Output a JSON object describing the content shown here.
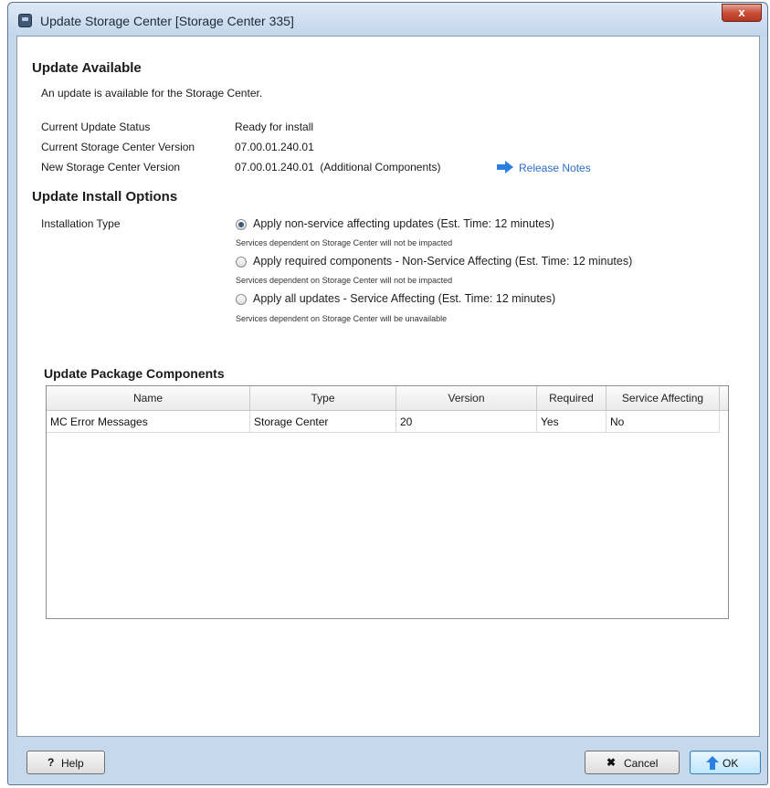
{
  "window": {
    "title": "Update Storage Center [Storage Center 335]",
    "close_glyph": "x"
  },
  "update_available": {
    "heading": "Update Available",
    "description": "An update is available for the Storage Center.",
    "rows": [
      {
        "label": "Current Update Status",
        "value": "Ready for install"
      },
      {
        "label": "Current Storage Center Version",
        "value": "07.00.01.240.01"
      },
      {
        "label": "New Storage Center Version",
        "value": "07.00.01.240.01  (Additional Components)"
      }
    ],
    "release_notes": {
      "label": "Release Notes",
      "icon": "arrow-right-icon"
    }
  },
  "install_options": {
    "heading": "Update Install Options",
    "type_label": "Installation Type",
    "options": [
      {
        "label": "Apply non-service affecting updates (Est. Time: 12 minutes)",
        "note": "Services dependent on Storage Center will not be impacted",
        "checked": true
      },
      {
        "label": "Apply required components - Non-Service Affecting (Est. Time: 12 minutes)",
        "note": "Services dependent on Storage Center will not be impacted",
        "checked": false
      },
      {
        "label": "Apply all updates - Service Affecting (Est. Time: 12 minutes)",
        "note": "Services dependent on Storage Center will be unavailable",
        "checked": false
      }
    ]
  },
  "components": {
    "heading": "Update Package Components",
    "columns": [
      "Name",
      "Type",
      "Version",
      "Required",
      "Service Affecting"
    ],
    "rows": [
      [
        "MC Error Messages",
        "Storage Center",
        "20",
        "Yes",
        "No"
      ]
    ]
  },
  "footer": {
    "help_label": "Help",
    "help_icon": "question-icon",
    "cancel_label": "Cancel",
    "cancel_icon": "x-icon",
    "ok_label": "OK",
    "ok_icon": "up-arrow-icon"
  },
  "colors": {
    "link": "#2a6fcf",
    "accent_arrow": "#2a7fe0"
  }
}
